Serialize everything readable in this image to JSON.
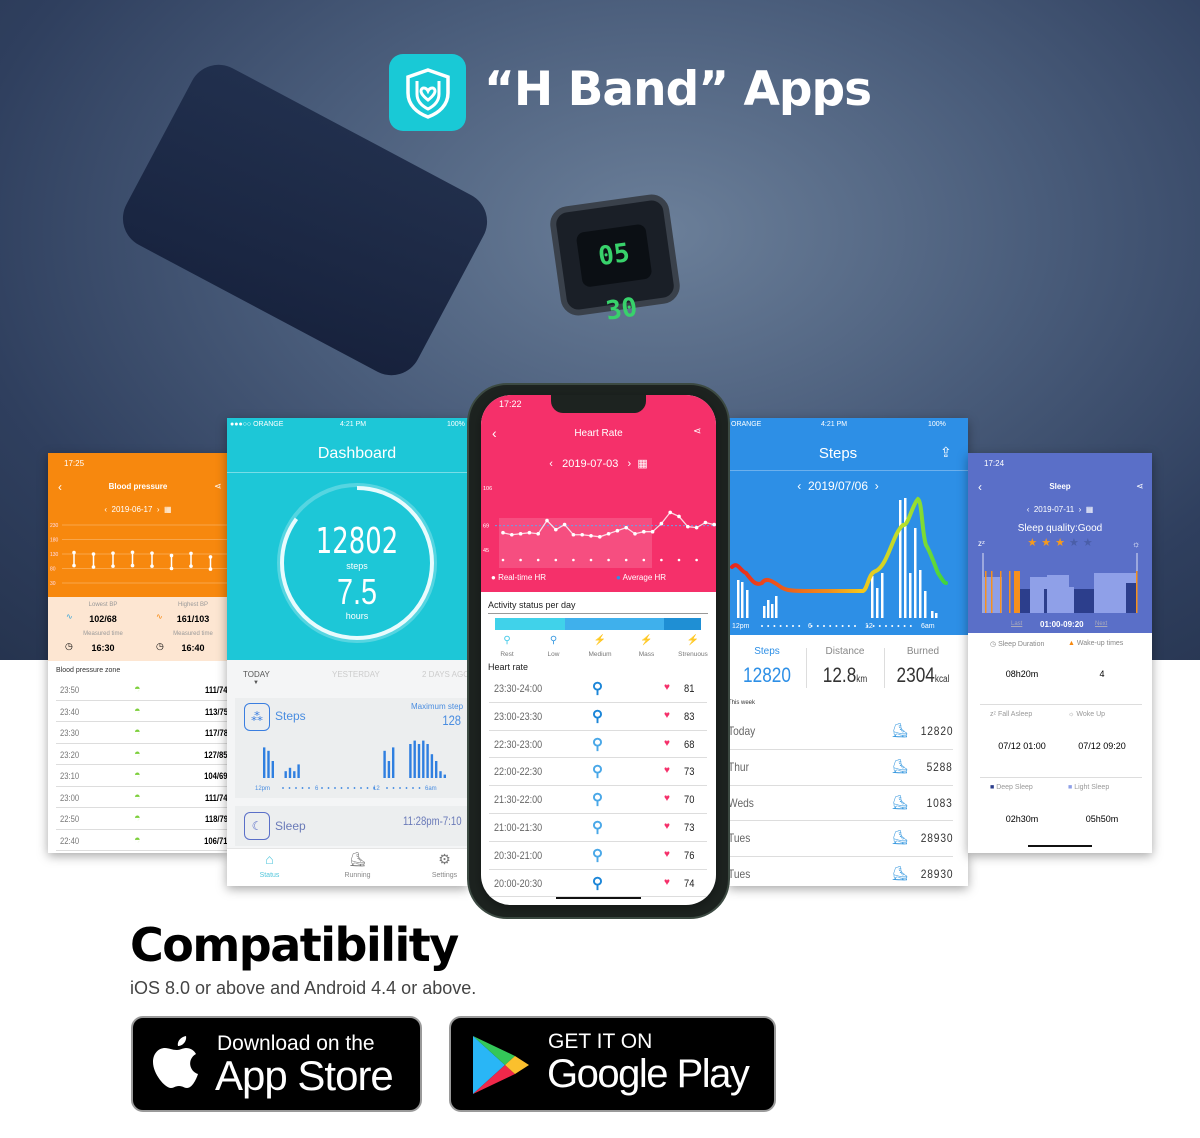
{
  "header": {
    "title": "“H Band” Apps",
    "app_icon": "shield-heart-icon",
    "watch_display": "05 30"
  },
  "colors": {
    "teal": "#1dc7d7",
    "orange": "#f7880e",
    "pink": "#f5306a",
    "blue": "#2d8fe6",
    "sleep_purple": "#5a6fc8"
  },
  "blood_pressure": {
    "status_time": "17:25",
    "title": "Blood pressure",
    "date": "2019-06-17",
    "y_ticks": [
      "230",
      "180",
      "130",
      "80",
      "30"
    ],
    "readings": [
      [
        135,
        90
      ],
      [
        130,
        85
      ],
      [
        133,
        88
      ],
      [
        136,
        90
      ],
      [
        133,
        88
      ],
      [
        125,
        80
      ],
      [
        132,
        88
      ],
      [
        120,
        78
      ]
    ],
    "lowest_label": "Lowest BP",
    "lowest": "102/68",
    "highest_label": "Highest BP",
    "highest": "161/103",
    "measured_label": "Measured time",
    "lowest_time": "16:30",
    "highest_time": "16:40",
    "zone_title": "Blood pressure zone",
    "rows": [
      [
        "23:50",
        "111/74"
      ],
      [
        "23:40",
        "113/75"
      ],
      [
        "23:30",
        "117/78"
      ],
      [
        "23:20",
        "127/85"
      ],
      [
        "23:10",
        "104/69"
      ],
      [
        "23:00",
        "111/74"
      ],
      [
        "22:50",
        "118/79"
      ],
      [
        "22:40",
        "106/71"
      ]
    ]
  },
  "dashboard": {
    "carrier": "●●●○○ ORANGE",
    "time": "4:21 PM",
    "battery": "100%",
    "title": "Dashboard",
    "steps": "12802",
    "steps_unit": "steps",
    "hours": "7.5",
    "hours_unit": "hours",
    "progress": 0.85,
    "tabs": [
      "TODAY",
      "YESTERDAY",
      "2 DAYS AGO"
    ],
    "steps_card": "Steps",
    "max_label": "Maximum step",
    "max_value": "128",
    "axis": [
      "12pm",
      "6",
      "12",
      "6am"
    ],
    "bars": [
      9,
      8,
      5,
      0,
      0,
      2,
      3,
      2,
      4,
      0,
      0,
      0,
      0,
      0,
      0,
      0,
      0,
      0,
      0,
      0,
      0,
      0,
      0,
      0,
      0,
      0,
      0,
      0,
      8,
      5,
      9,
      0,
      0,
      0,
      10,
      11,
      10,
      11,
      10,
      7,
      5,
      2,
      1
    ],
    "sleep_card": "Sleep",
    "sleep_range": "11:28pm-7:10",
    "nav": [
      "Status",
      "Running",
      "Settings"
    ]
  },
  "heart_rate": {
    "status_time": "17:22",
    "title": "Heart Rate",
    "date": "2019-07-03",
    "y_ticks": [
      "106",
      "69",
      "45"
    ],
    "values": [
      62,
      60,
      61,
      62,
      61,
      74,
      65,
      70,
      60,
      60,
      59,
      58,
      61,
      64,
      67,
      61,
      63,
      63,
      71,
      82,
      78,
      68,
      67,
      72,
      70
    ],
    "legend_realtime": "Real-time HR",
    "legend_average": "Average HR",
    "activity_title": "Activity status per day",
    "activity_levels": [
      "Rest",
      "Low",
      "Medium",
      "Mass",
      "Strenuous"
    ],
    "list_title": "Heart rate",
    "rows": [
      [
        "23:30-24:00",
        "medium",
        81
      ],
      [
        "23:00-23:30",
        "medium",
        83
      ],
      [
        "22:30-23:00",
        "low",
        68
      ],
      [
        "22:00-22:30",
        "low",
        73
      ],
      [
        "21:30-22:00",
        "low",
        70
      ],
      [
        "21:00-21:30",
        "low",
        73
      ],
      [
        "20:30-21:00",
        "low",
        76
      ],
      [
        "20:00-20:30",
        "medium",
        74
      ]
    ]
  },
  "steps": {
    "carrier": "ORANGE",
    "time": "4:21 PM",
    "battery": "100%",
    "title": "Steps",
    "date": "2019/07/06",
    "axis": [
      "12pm",
      "6",
      "12",
      "6am"
    ],
    "stats": [
      {
        "label": "Steps",
        "value": "12820",
        "unit": ""
      },
      {
        "label": "Distance",
        "value": "12.8",
        "unit": "km"
      },
      {
        "label": "Burned",
        "value": "2304",
        "unit": "kcal"
      }
    ],
    "week_label": "This week",
    "rows": [
      [
        "Today",
        "12820"
      ],
      [
        "Thur",
        "5288"
      ],
      [
        "Weds",
        "1083"
      ],
      [
        "Tues",
        "28930"
      ],
      [
        "Tues",
        "28930"
      ]
    ]
  },
  "sleep": {
    "status_time": "17:24",
    "title": "Sleep",
    "date": "2019-07-11",
    "quality": "Sleep quality:Good",
    "stars": 3,
    "stars_max": 5,
    "prev": "Last",
    "range": "01:00-09:20",
    "next": "Next",
    "duration_label": "Sleep Duration",
    "duration": "08h20m",
    "wake_label": "Wake-up times",
    "wake": "4",
    "fall_label": "Fall Asleep",
    "fall": "07/12 01:00",
    "woke_label": "Woke Up",
    "woke": "07/12 09:20",
    "deep_label": "Deep Sleep",
    "deep": "02h30m",
    "light_label": "Light Sleep",
    "light": "05h50m"
  },
  "compatibility": {
    "title": "Compatibility",
    "subtitle": "iOS 8.0 or above and Android 4.4 or above."
  },
  "stores": {
    "apple_small": "Download on the",
    "apple_big": "App Store",
    "google_small": "GET IT ON",
    "google_big": "Google Play"
  }
}
